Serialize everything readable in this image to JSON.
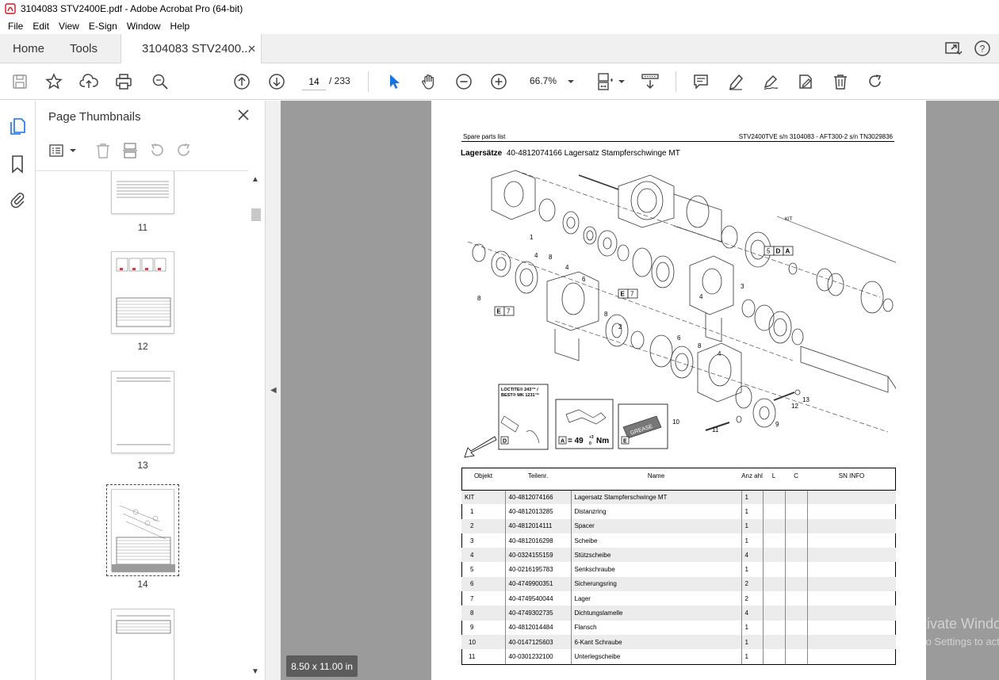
{
  "window": {
    "title": "3104083 STV2400E.pdf - Adobe Acrobat Pro (64-bit)"
  },
  "menu": [
    "File",
    "Edit",
    "View",
    "E-Sign",
    "Window",
    "Help"
  ],
  "tabs": {
    "home": "Home",
    "tools": "Tools",
    "document": "3104083 STV2400..."
  },
  "toolbar": {
    "page_current": "14",
    "page_total": "/  233",
    "zoom": "66.7%"
  },
  "panel": {
    "title": "Page Thumbnails",
    "thumbnails": [
      {
        "label": "11"
      },
      {
        "label": "12"
      },
      {
        "label": "13"
      },
      {
        "label": "14",
        "selected": true
      },
      {
        "label": ""
      }
    ]
  },
  "page": {
    "header_left": "Spare parts list",
    "header_right": "STV2400TVE s/n 3104083 - AFT300-2 s/n TN3029836",
    "title_bold": "Lagersätze",
    "title_rest": "40-4812074166 Lagersatz Stampferschwinge MT",
    "diagram_labels": {
      "kit": "KIT",
      "loctite": "LOCTITE® 243™ /",
      "best": "BEST® MK 1231™",
      "torque_a": "A",
      "torque_value": "= 49",
      "torque_sup": "+3",
      "torque_sub": "0",
      "torque_unit": "Nm",
      "grease": "GREASE",
      "box_d": "D",
      "box_e": "E",
      "seven": "7",
      "five": "5",
      "numbers": [
        "1",
        "2",
        "3",
        "4",
        "6",
        "8",
        "9",
        "10",
        "11",
        "12",
        "13",
        "14",
        "15"
      ]
    },
    "table": {
      "headers": [
        "Objekt",
        "Teilenr.",
        "Name",
        "Anz ahl",
        "L",
        "C",
        "SN INFO"
      ],
      "rows": [
        [
          "KIT",
          "40-4812074166",
          "Lagersatz Stampferschwinge MT",
          "1"
        ],
        [
          "1",
          "40-4812013285",
          "Distanzring",
          "1"
        ],
        [
          "2",
          "40-4812014111",
          "Spacer",
          "1"
        ],
        [
          "3",
          "40-4812016298",
          "Scheibe",
          "1"
        ],
        [
          "4",
          "40-0324155159",
          "Stützscheibe",
          "4"
        ],
        [
          "5",
          "40-0216195783",
          "Senkschraube",
          "1"
        ],
        [
          "6",
          "40-4749900351",
          "Sicherungsring",
          "2"
        ],
        [
          "7",
          "40-4749540044",
          "Lager",
          "2"
        ],
        [
          "8",
          "40-4749302735",
          "Dichtungslamelle",
          "4"
        ],
        [
          "9",
          "40-4812014484",
          "Flansch",
          "1"
        ],
        [
          "10",
          "40-0147125603",
          "6-Kant Schraube",
          "1"
        ],
        [
          "11",
          "40-0301232100",
          "Unterlegscheibe",
          "1"
        ]
      ]
    }
  },
  "status": {
    "page_size": "8.50 x 11.00 in"
  },
  "watermark": {
    "line1": "Activate Windows",
    "line2": "Go to Settings to activate Windows."
  }
}
